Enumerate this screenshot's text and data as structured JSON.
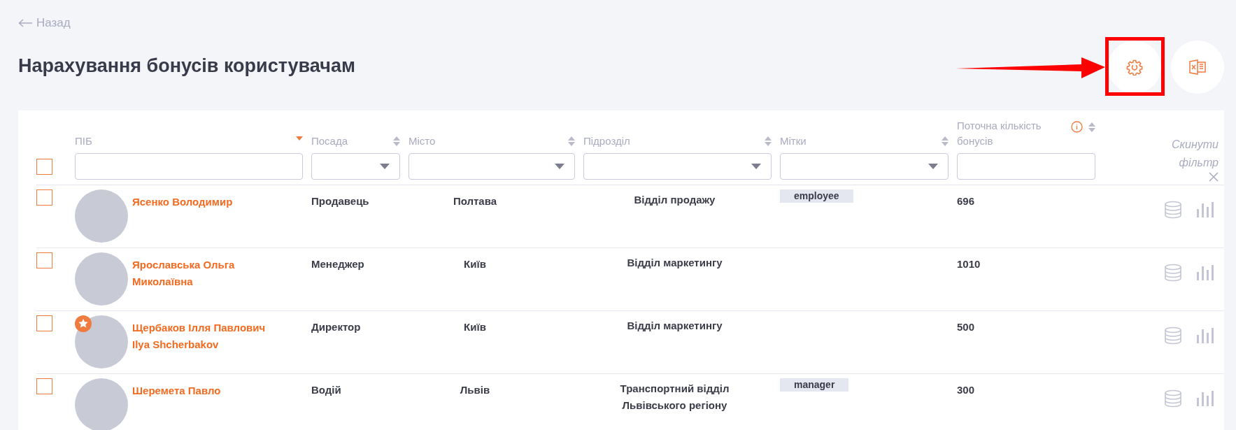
{
  "back_link": {
    "label": "Назад"
  },
  "title": "Нарахування бонусів користувачам",
  "toolbar_buttons": [
    {
      "kind": "settings",
      "highlighted": true
    },
    {
      "kind": "excel",
      "highlighted": false
    }
  ],
  "select_all": {
    "checked": false
  },
  "columns": [
    {
      "label": "ПІБ",
      "sorted": true,
      "kind": "text",
      "info": false
    },
    {
      "label": "Посада",
      "sorted": false,
      "kind": "select",
      "info": false
    },
    {
      "label": "Місто",
      "sorted": false,
      "kind": "select",
      "info": false
    },
    {
      "label": "Підрозділ",
      "sorted": false,
      "kind": "select",
      "info": false
    },
    {
      "label": "Мітки",
      "sorted": false,
      "kind": "select",
      "info": false
    },
    {
      "label": "Поточна кількість бонусів",
      "sorted": false,
      "kind": "text",
      "info": true
    }
  ],
  "reset_filter": "Скинути фільтр",
  "rows": [
    {
      "checked": false,
      "starred": false,
      "name": "Ясенко Володимир",
      "position": "Продавець",
      "city": "Полтава",
      "department": "Відділ продажу",
      "tags": [
        "employee"
      ],
      "bonuses": "696"
    },
    {
      "checked": false,
      "starred": false,
      "name": "Ярославська Ольга Миколаївна",
      "position": "Менеджер",
      "city": "Київ",
      "department": "Відділ маркетингу",
      "tags": [],
      "bonuses": "1010"
    },
    {
      "checked": false,
      "starred": true,
      "name": "Щербаков Ілля Павлович",
      "alt_name": "Ilya Shcherbakov",
      "position": "Директор",
      "city": "Київ",
      "department": "Відділ маркетингу",
      "tags": [],
      "bonuses": "500"
    },
    {
      "checked": false,
      "starred": false,
      "name": "Шеремета Павло",
      "position": "Водій",
      "city": "Львів",
      "department": "Транспортний відділ Львівського регіону",
      "tags": [
        "manager"
      ],
      "bonuses": "300"
    }
  ]
}
